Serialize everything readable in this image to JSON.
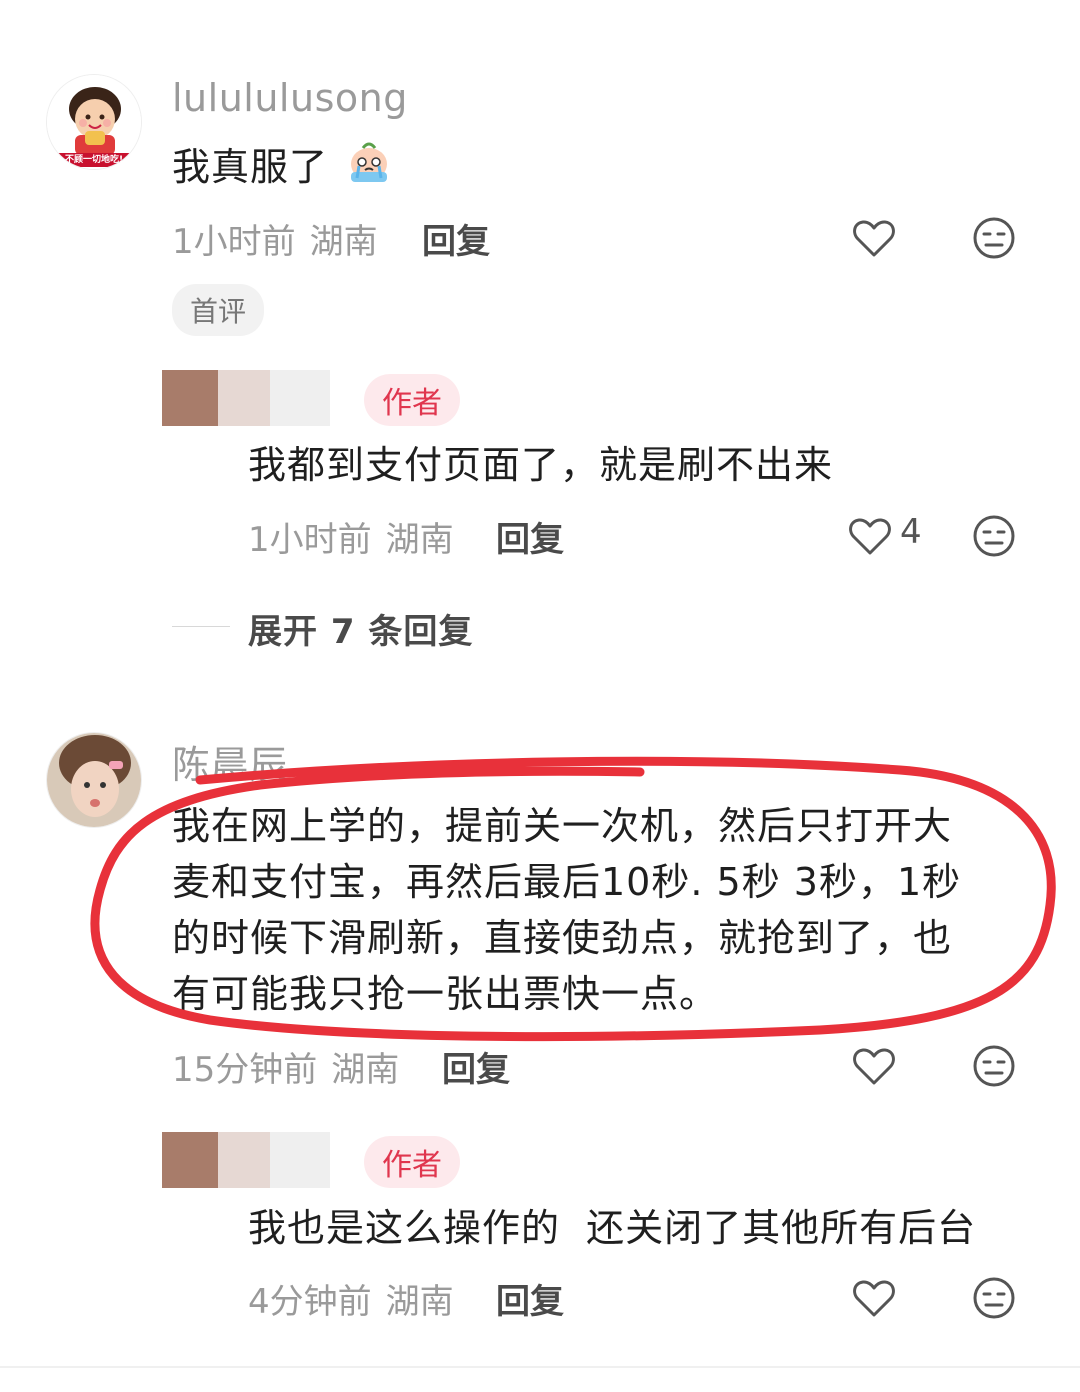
{
  "comments": [
    {
      "username": "lulululusong",
      "avatar_banner_text": "不顾一切地吃!",
      "content": "我真服了",
      "emoji": "crying-face-emoji",
      "time": "1小时前",
      "location": "湖南",
      "reply_label": "回复",
      "badge": "首评",
      "reply": {
        "author_badge": "作者",
        "content": "我都到支付页面了，就是刷不出来",
        "time": "1小时前",
        "location": "湖南",
        "reply_label": "回复",
        "like_count": "4"
      },
      "expand_label": "展开 7 条回复"
    },
    {
      "username": "陈晨辰",
      "content_lines": [
        "我在网上学的，提前关一次机，然后只打开大",
        "麦和支付宝，再然后最后10秒. 5秒  3秒，1秒",
        "的时候下滑刷新，直接使劲点，就抢到了，也",
        "有可能我只抢一张出票快一点。"
      ],
      "time": "15分钟前",
      "location": "湖南",
      "reply_label": "回复",
      "reply": {
        "author_badge": "作者",
        "content": "我也是这么操作的  还关闭了其他所有后台",
        "time": "4分钟前",
        "location": "湖南",
        "reply_label": "回复"
      }
    }
  ],
  "colors": {
    "highlight_ring": "#e8313a",
    "author_badge_bg": "#fde9ec",
    "author_badge_text": "#e0364e"
  }
}
